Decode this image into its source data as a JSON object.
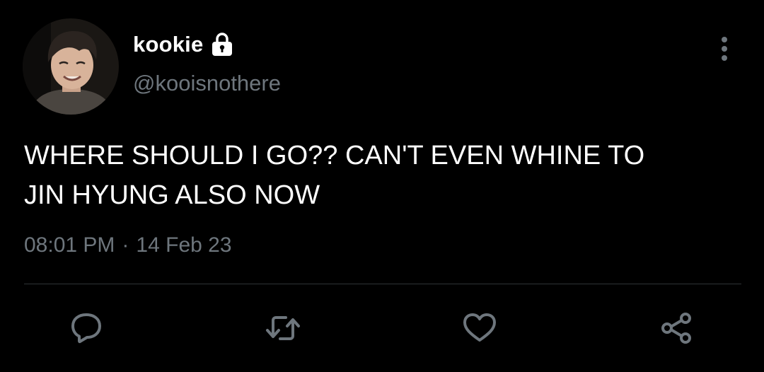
{
  "tweet": {
    "author": {
      "display_name": "kookie",
      "handle": "@kooisnothere",
      "protected_icon": "lock-icon",
      "avatar": "profile-photo"
    },
    "text": "WHERE SHOULD I GO?? CAN'T EVEN WHINE TO\nJIN HYUNG ALSO NOW",
    "time": "08:01 PM",
    "separator": "·",
    "date": "14 Feb 23"
  },
  "actions": [
    {
      "name": "reply",
      "icon": "speech-bubble-icon"
    },
    {
      "name": "retweet",
      "icon": "retweet-arrows-icon"
    },
    {
      "name": "like",
      "icon": "heart-icon"
    },
    {
      "name": "share",
      "icon": "share-nodes-icon"
    }
  ],
  "menu": {
    "icon": "vertical-ellipsis-icon"
  },
  "colors": {
    "background": "#000000",
    "primary_text": "#ffffff",
    "secondary_text": "#6e767d",
    "divider": "#2f3336"
  }
}
